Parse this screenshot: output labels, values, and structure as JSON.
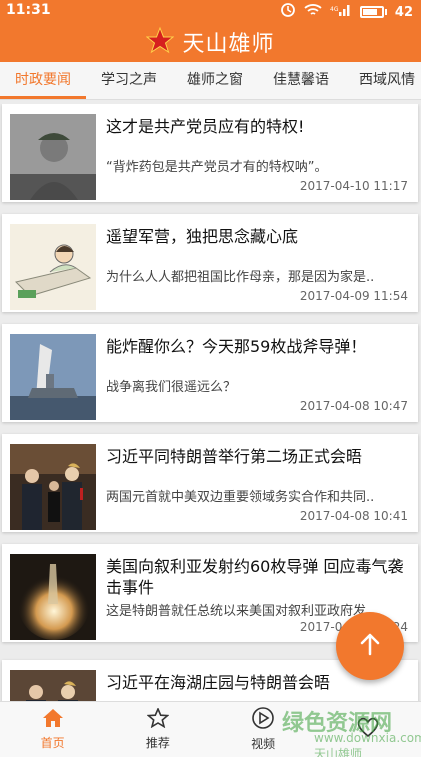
{
  "status_bar": {
    "time": "11:31",
    "battery": "42",
    "network": "4G"
  },
  "app_bar": {
    "title": "天山雄师",
    "logo_icon": "red-star-icon"
  },
  "tabs": [
    {
      "label": "时政要闻",
      "active": true
    },
    {
      "label": "学习之声",
      "active": false
    },
    {
      "label": "雄师之窗",
      "active": false
    },
    {
      "label": "佳慧馨语",
      "active": false
    },
    {
      "label": "西域风情",
      "active": false
    }
  ],
  "articles": [
    {
      "title": "这才是共产党员应有的特权!",
      "summary": "“背炸药包是共产党员才有的特权呐”。",
      "date": "2017-04-10 11:17"
    },
    {
      "title": "遥望军营，独把思念藏心底",
      "summary": "为什么人人都把祖国比作母亲，那是因为家是..",
      "date": "2017-04-09 11:54"
    },
    {
      "title": "能炸醒你么？今天那59枚战斧导弹！",
      "summary": "战争离我们很遥远么？",
      "date": "2017-04-08 10:47"
    },
    {
      "title": "习近平同特朗普举行第二场正式会晤",
      "summary": "两国元首就中美双边重要领域务实合作和共同..",
      "date": "2017-04-08 10:41"
    },
    {
      "title": "美国向叙利亚发射约60枚导弹 回应毒气袭击事件",
      "summary": "这是特朗普就任总统以来美国对叙利亚政府发..",
      "date": "2017-04-08 10:24"
    },
    {
      "title": "习近平在海湖庄园与特朗普会晤",
      "summary": "",
      "date": ""
    }
  ],
  "bottom_nav": [
    {
      "label": "首页",
      "icon": "home-icon",
      "active": true
    },
    {
      "label": "推荐",
      "icon": "star-icon",
      "active": false
    },
    {
      "label": "视频",
      "icon": "play-icon",
      "active": false
    },
    {
      "label": "",
      "icon": "heart-icon",
      "active": false
    }
  ],
  "watermark": {
    "text": "绿色资源网",
    "sub": "www.downxia.com 天山雄师"
  },
  "colors": {
    "brand": "#f2782d",
    "background": "#ececec"
  }
}
